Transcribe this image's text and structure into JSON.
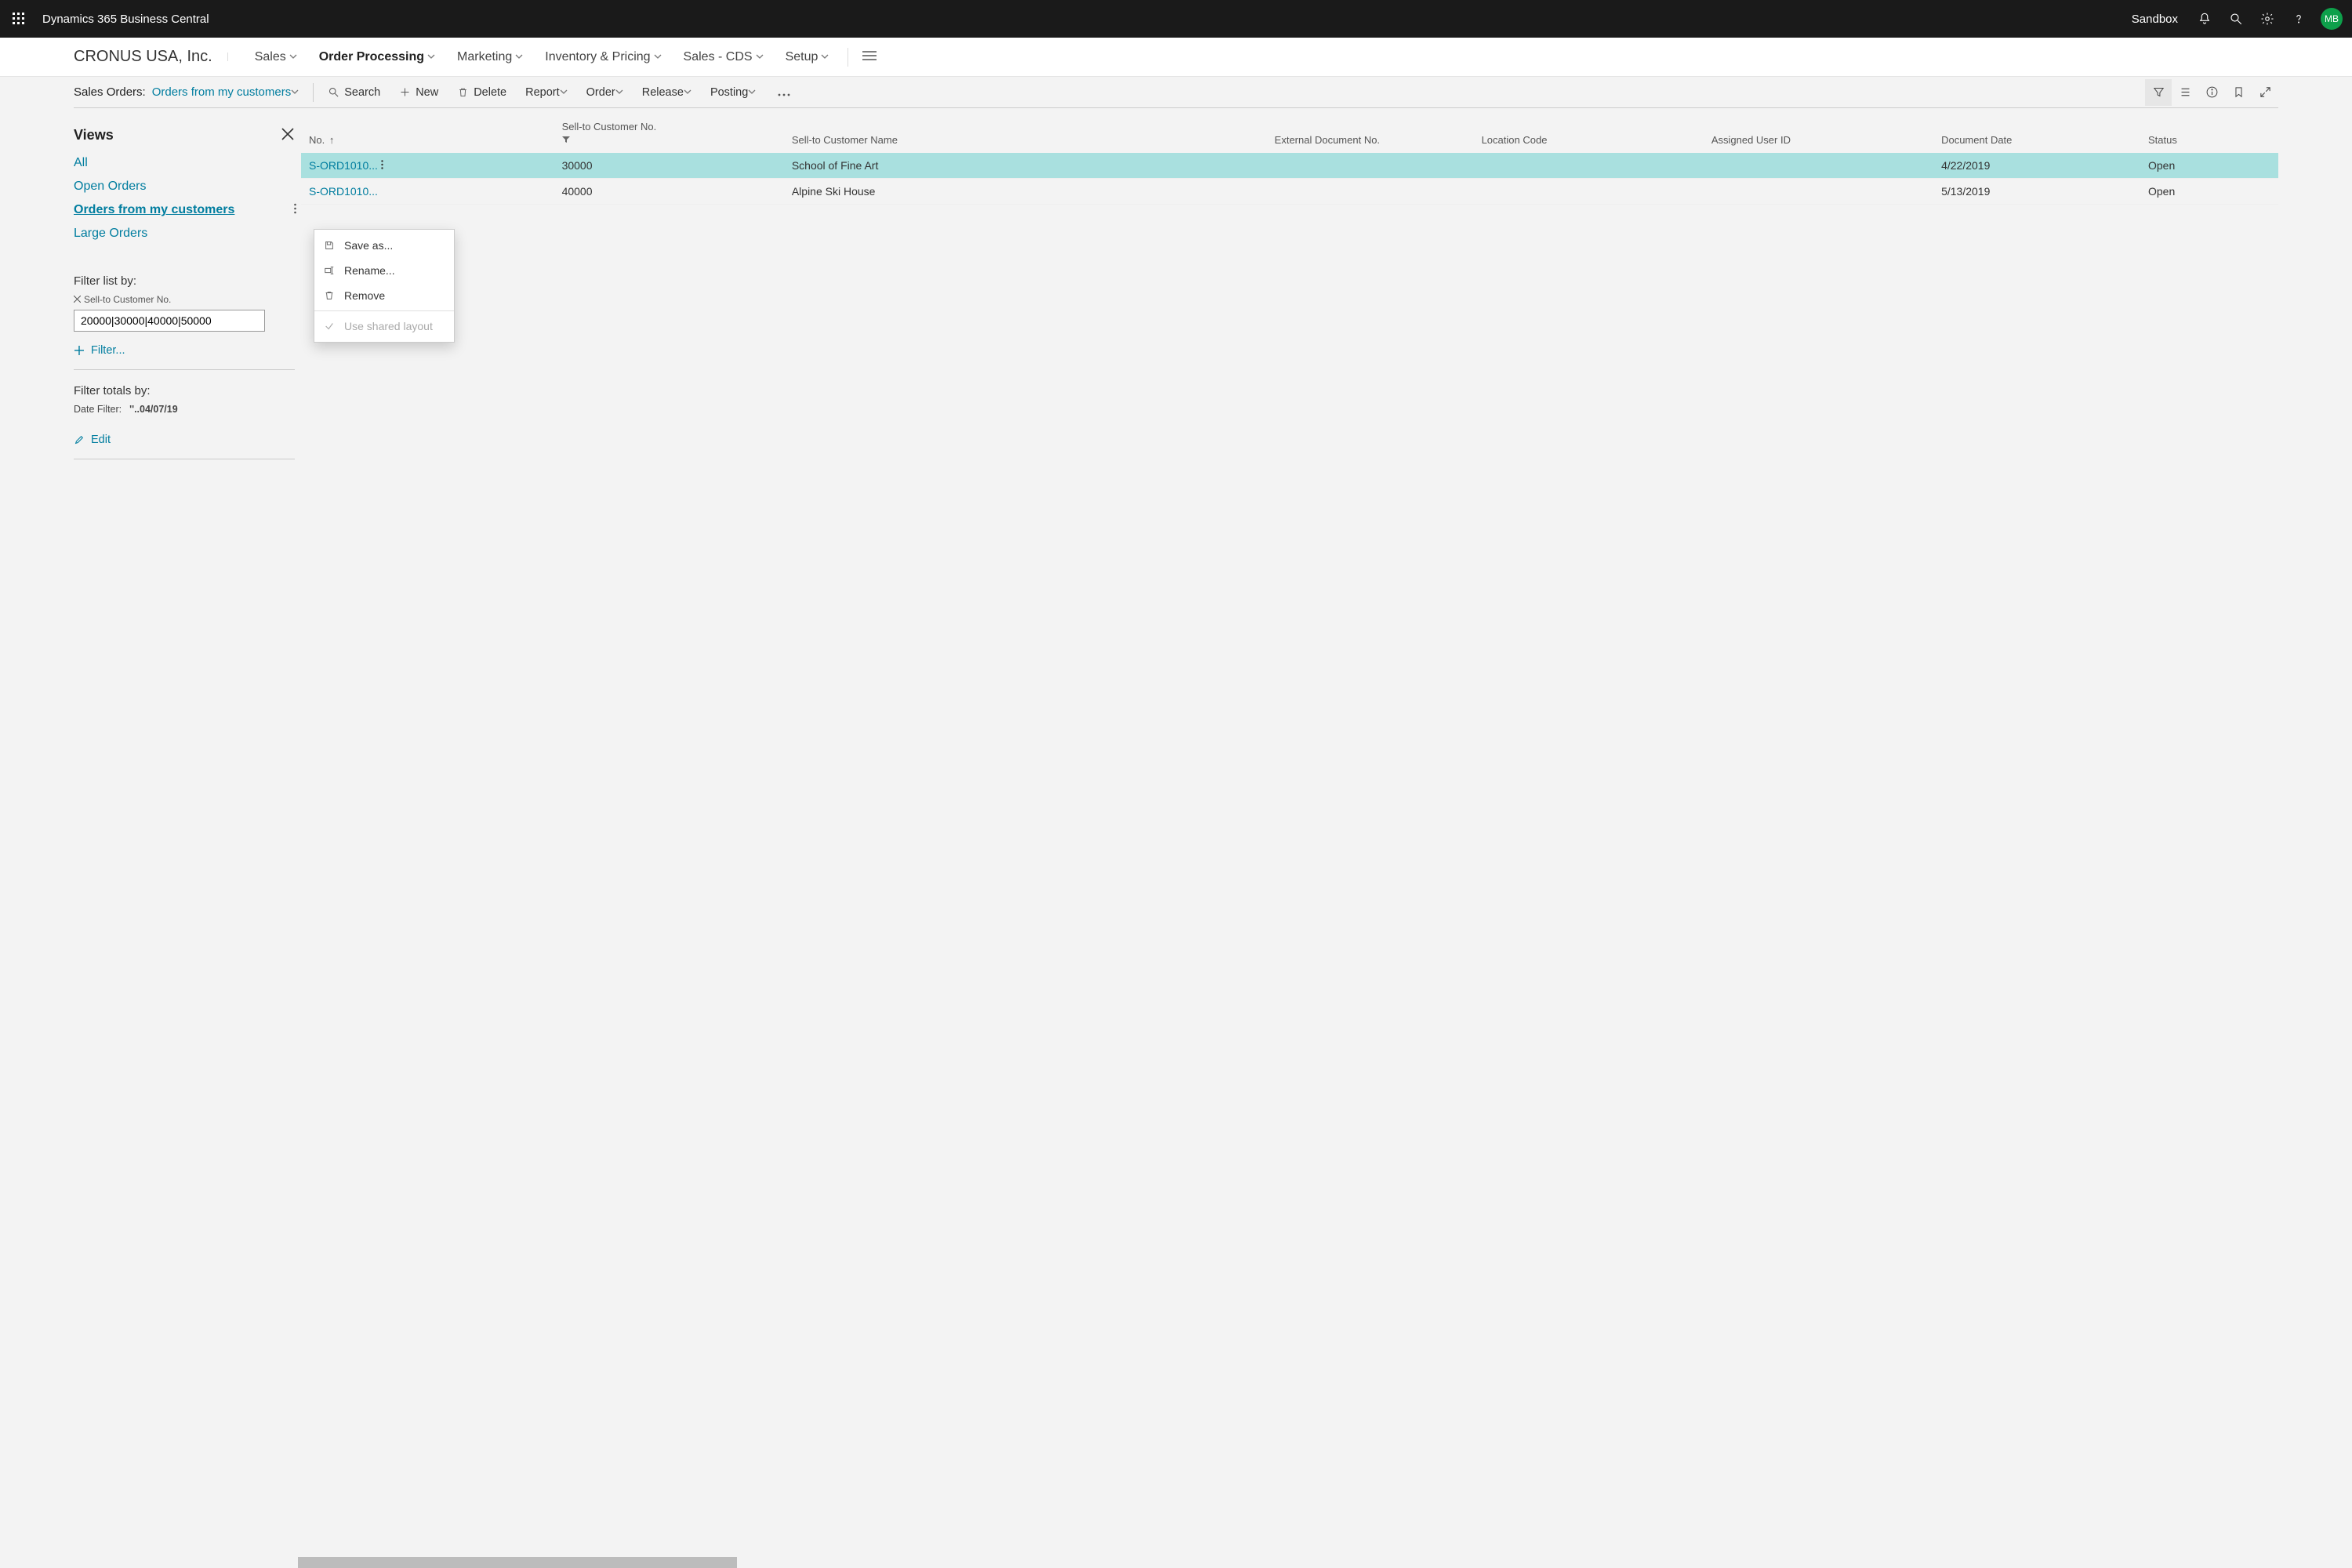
{
  "header": {
    "product": "Dynamics 365 Business Central",
    "env": "Sandbox",
    "avatar": "MB"
  },
  "nav": {
    "company": "CRONUS USA, Inc.",
    "items": [
      {
        "label": "Sales",
        "active": false
      },
      {
        "label": "Order Processing",
        "active": true
      },
      {
        "label": "Marketing",
        "active": false
      },
      {
        "label": "Inventory & Pricing",
        "active": false
      },
      {
        "label": "Sales - CDS",
        "active": false
      },
      {
        "label": "Setup",
        "active": false
      }
    ]
  },
  "actionbar": {
    "breadcrumb_label": "Sales Orders:",
    "breadcrumb_view": "Orders from my customers",
    "actions": {
      "search": "Search",
      "new": "New",
      "delete": "Delete",
      "report": "Report",
      "order": "Order",
      "release": "Release",
      "posting": "Posting"
    }
  },
  "views": {
    "heading": "Views",
    "list": [
      {
        "label": "All",
        "selected": false
      },
      {
        "label": "Open Orders",
        "selected": false
      },
      {
        "label": "Orders from my customers",
        "selected": true
      },
      {
        "label": "Large Orders",
        "selected": false
      }
    ],
    "filter_by_label": "Filter list by:",
    "filter_field": "Sell-to Customer No.",
    "filter_value": "20000|30000|40000|50000",
    "add_filter": "Filter...",
    "totals_label": "Filter totals by:",
    "date_filter_label": "Date Filter:",
    "date_filter_value": "''..04/07/19",
    "edit": "Edit"
  },
  "context_menu": {
    "save_as": "Save as...",
    "rename": "Rename...",
    "remove": "Remove",
    "shared": "Use shared layout"
  },
  "table": {
    "columns": {
      "no": "No.",
      "sell_to_no": "Sell-to Customer No.",
      "sell_to_name": "Sell-to Customer Name",
      "ext_doc": "External Document No.",
      "location": "Location Code",
      "assigned": "Assigned User ID",
      "doc_date": "Document Date",
      "status": "Status"
    },
    "rows": [
      {
        "no": "S-ORD1010...",
        "sell_to_no": "30000",
        "sell_to_name": "School of Fine Art",
        "ext_doc": "",
        "location": "",
        "assigned": "",
        "doc_date": "4/22/2019",
        "status": "Open",
        "selected": true
      },
      {
        "no": "S-ORD1010...",
        "sell_to_no": "40000",
        "sell_to_name": "Alpine Ski House",
        "ext_doc": "",
        "location": "",
        "assigned": "",
        "doc_date": "5/13/2019",
        "status": "Open",
        "selected": false
      }
    ]
  }
}
